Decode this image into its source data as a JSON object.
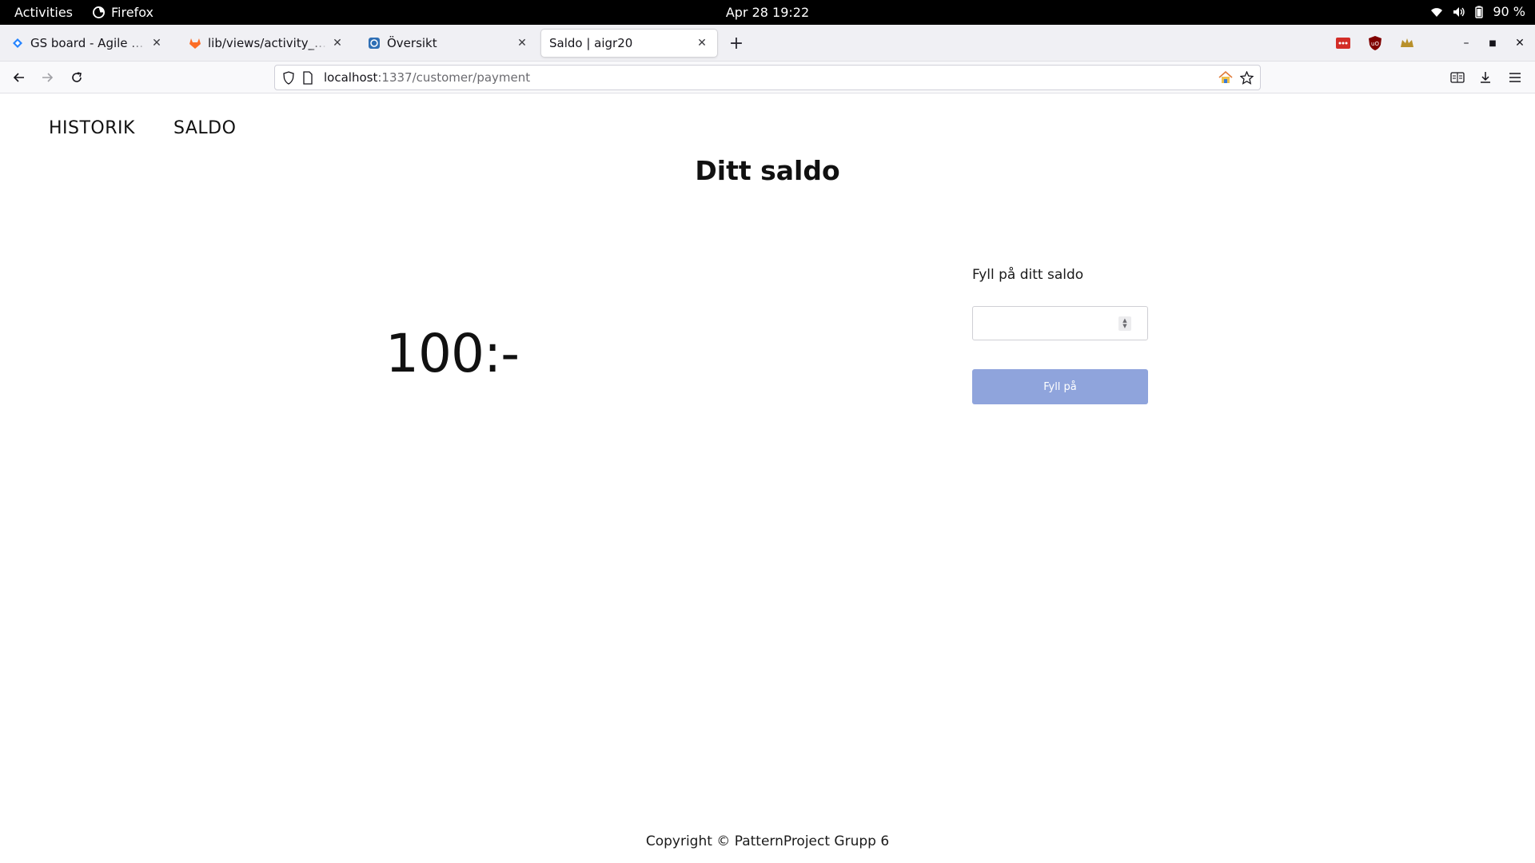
{
  "system_bar": {
    "activities_label": "Activities",
    "app_name": "Firefox",
    "clock": "Apr 28  19:22",
    "battery_label": "90 %"
  },
  "tabs": [
    {
      "title": "GS board - Agile board - Jira",
      "favicon": "jira-icon",
      "active": false
    },
    {
      "title": "lib/views/activity_view.dart",
      "favicon": "gitlab-icon",
      "active": false
    },
    {
      "title": "Översikt",
      "favicon": "site-icon",
      "active": false
    },
    {
      "title": "Saldo | aigr20",
      "favicon": "",
      "active": true
    }
  ],
  "urlbar": {
    "host": "localhost",
    "path": ":1337/customer/payment"
  },
  "site": {
    "nav": [
      {
        "label": "HISTORIK"
      },
      {
        "label": "SALDO"
      }
    ],
    "title": "Ditt saldo",
    "balance": "100:-",
    "topup_label": "Fyll på ditt saldo",
    "topup_input_value": "",
    "topup_button": "Fyll på",
    "footer": "Copyright © PatternProject Grupp 6"
  },
  "colors": {
    "button_bg": "#8fa4dc",
    "tab_strip_bg": "#f0f0f4",
    "topbar_bg": "#000000"
  }
}
